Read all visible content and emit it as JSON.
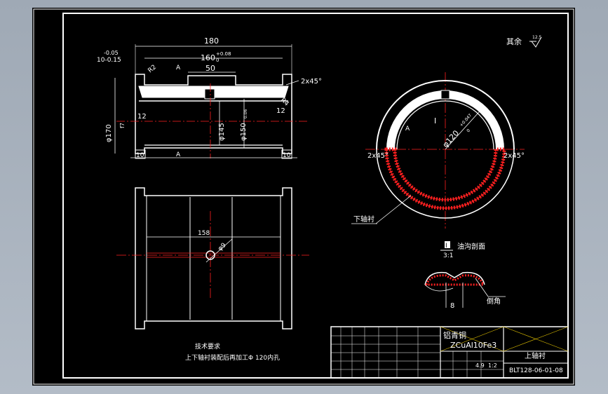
{
  "colors": {
    "outline": "#ffffff",
    "dimension": "#ffffff",
    "center_line": "#ff2020",
    "hatch": "#ff2020",
    "background": "#000000"
  },
  "surface_note": {
    "text": "其余",
    "roughness": "12.5"
  },
  "section_view": {
    "overall_length": "180",
    "tolerance_upper": "-0.05",
    "tolerance_lower": "10-0.15",
    "inner_length": "160",
    "inner_tol_upper": "+0.08",
    "inner_tol_lower": "0",
    "groove_width": "50",
    "chamfer": "2x45°",
    "radius_left": "R2",
    "radius_right": "R4",
    "outer_dia": "φ170",
    "bore_dia": "φ145",
    "inner_dia": "φ150",
    "inner_dia_tol": "0.06",
    "flange_left": "12",
    "flange_right": "12",
    "end_left": "10",
    "end_right": "10",
    "datum_a": "A",
    "fit_mark": "f7"
  },
  "end_view": {
    "bore_dia": "φ120",
    "bore_tol": "+0.047",
    "bore_tol_lower": "0",
    "chamfer_left": "2x45°",
    "chamfer_right": "2x45°",
    "lower_label": "下轴衬",
    "section_mark": "I",
    "datum": "A"
  },
  "plan_view": {
    "length": "158",
    "hole_dia": "φ9"
  },
  "detail": {
    "title": "油沟剖面",
    "mark": "I",
    "scale": "3:1",
    "width": "8",
    "chamfer_label": "倒角"
  },
  "requirements": {
    "title": "技术要求",
    "line1": "上下轴衬装配后再加工Φ 120内孔"
  },
  "title_block": {
    "material": "铝青铜",
    "material_code": "ZCuAl10Fe3",
    "part_name": "上轴衬",
    "drawing_no": "BLT128-06-01-08",
    "scale": "1:2",
    "weight": "4.9"
  }
}
